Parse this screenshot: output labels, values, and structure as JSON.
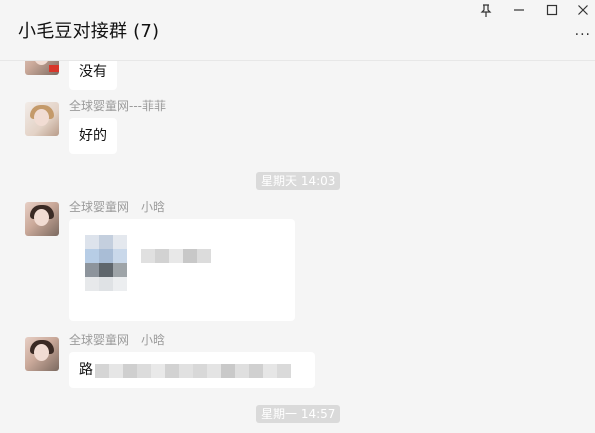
{
  "window": {
    "title": "小毛豆对接群 (7)",
    "pin_icon": "pin-icon",
    "minimize_icon": "minimize-icon",
    "maximize_icon": "maximize-icon",
    "close_icon": "close-icon",
    "more_icon": "more-dots-icon"
  },
  "messages": [
    {
      "type": "text",
      "text": "没有"
    },
    {
      "type": "text",
      "sender": "全球婴童网---菲菲",
      "text": "好的"
    },
    {
      "type": "time",
      "text": "星期天 14:03"
    },
    {
      "type": "image",
      "sender": "全球婴童网　小晗"
    },
    {
      "type": "text",
      "sender": "全球婴童网　小晗",
      "text": "路"
    },
    {
      "type": "time",
      "text": "星期一 14:57"
    }
  ]
}
